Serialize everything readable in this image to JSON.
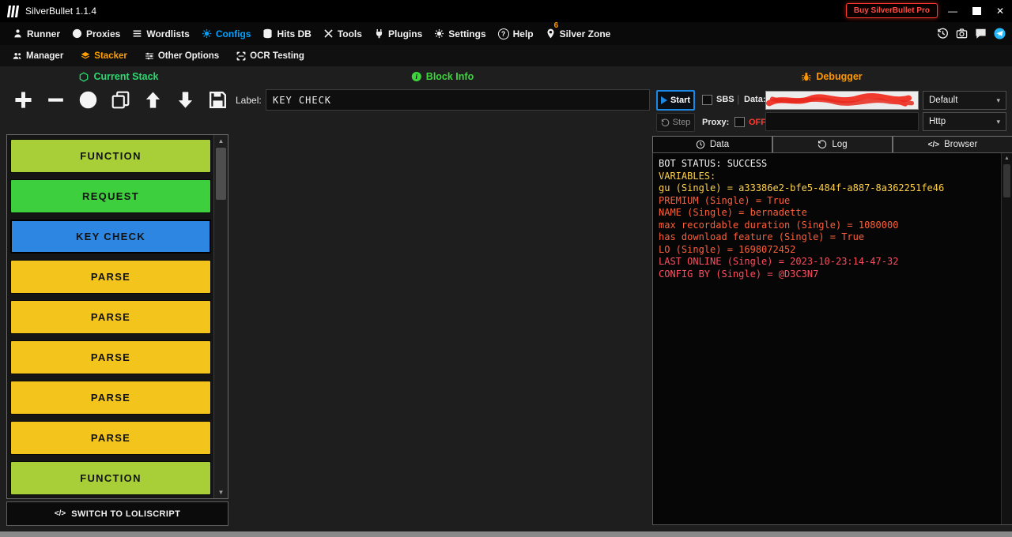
{
  "window": {
    "title": "SilverBullet 1.1.4",
    "buy_pro_label": "Buy SilverBullet Pro",
    "minimize_glyph": "—",
    "close_glyph": "✕"
  },
  "menubar": {
    "items": {
      "runner": "Runner",
      "proxies": "Proxies",
      "wordlists": "Wordlists",
      "configs": "Configs",
      "hits_db": "Hits DB",
      "tools": "Tools",
      "plugins": "Plugins",
      "settings": "Settings",
      "help": "Help",
      "silver_zone": "Silver Zone"
    },
    "silver_zone_badge": "6",
    "active_item": "Configs",
    "active_color": "#00a2ff"
  },
  "submenu": {
    "manager": "Manager",
    "stacker": "Stacker",
    "other_options": "Other Options",
    "ocr_testing": "OCR Testing",
    "active_item": "Stacker",
    "active_color": "#ffa000"
  },
  "section_headers": {
    "current_stack": "Current Stack",
    "block_info": "Block Info",
    "debugger": "Debugger",
    "current_stack_color": "#2bd96f",
    "block_info_color": "#3cd63c",
    "debugger_color": "#ff9800"
  },
  "stack_panel": {
    "label_caption": "Label:",
    "label_value": "KEY CHECK",
    "blocks": [
      {
        "label": "FUNCTION",
        "color": "#a8ce38",
        "selected": false
      },
      {
        "label": "REQUEST",
        "color": "#3ecf3e",
        "selected": false
      },
      {
        "label": "KEY CHECK",
        "color": "#2d87e2",
        "selected": true
      },
      {
        "label": "PARSE",
        "color": "#f3c51c",
        "selected": false
      },
      {
        "label": "PARSE",
        "color": "#f3c51c",
        "selected": false
      },
      {
        "label": "PARSE",
        "color": "#f3c51c",
        "selected": false
      },
      {
        "label": "PARSE",
        "color": "#f3c51c",
        "selected": false
      },
      {
        "label": "PARSE",
        "color": "#f3c51c",
        "selected": false
      },
      {
        "label": "FUNCTION",
        "color": "#a8ce38",
        "selected": false
      }
    ],
    "switch_icon": "</>",
    "switch_label": "SWITCH TO LOLISCRIPT"
  },
  "debugger": {
    "start_label": "Start",
    "step_label": "Step",
    "sbs_label": "SBS",
    "separator": "|",
    "data_label": "Data:",
    "data_value_redacted": true,
    "redaction_color": "#f03a2e",
    "proxy_label": "Proxy:",
    "proxy_state": "OFF",
    "proxy_state_color": "#ff3b30",
    "wordlist_type_value": "Default",
    "proxy_type_value": "Http",
    "tabs": {
      "data": "Data",
      "log": "Log",
      "browser": "Browser",
      "browser_icon": "</>",
      "active": "Data"
    },
    "log_lines": [
      {
        "text": "BOT STATUS: SUCCESS",
        "color": "#f2f2f2"
      },
      {
        "text": "VARIABLES:",
        "color": "#ffd24a"
      },
      {
        "text": "gu (Single) = a33386e2-bfe5-484f-a887-8a362251fe46",
        "color": "#ffd24a"
      },
      {
        "text": "PREMIUM (Single) = True",
        "color": "#ff5e3a"
      },
      {
        "text": "NAME (Single) = bernadette",
        "color": "#ff5e3a"
      },
      {
        "text": "max recordable duration (Single) = 1080000",
        "color": "#ff5e3a"
      },
      {
        "text": "has download feature (Single) = True",
        "color": "#ff5e3a"
      },
      {
        "text": "LO (Single) = 1698072452",
        "color": "#ff5e3a"
      },
      {
        "text": "LAST ONLINE (Single) = 2023-10-23:14-47-32",
        "color": "#ff4d5e"
      },
      {
        "text": "CONFIG BY (Single) = @D3C3N7",
        "color": "#ff4d5e"
      }
    ]
  },
  "icons": {
    "scroll_up": "▲",
    "scroll_down": "▼",
    "chevron_down": "▾",
    "help_glyph": "?",
    "info_glyph": "i"
  }
}
